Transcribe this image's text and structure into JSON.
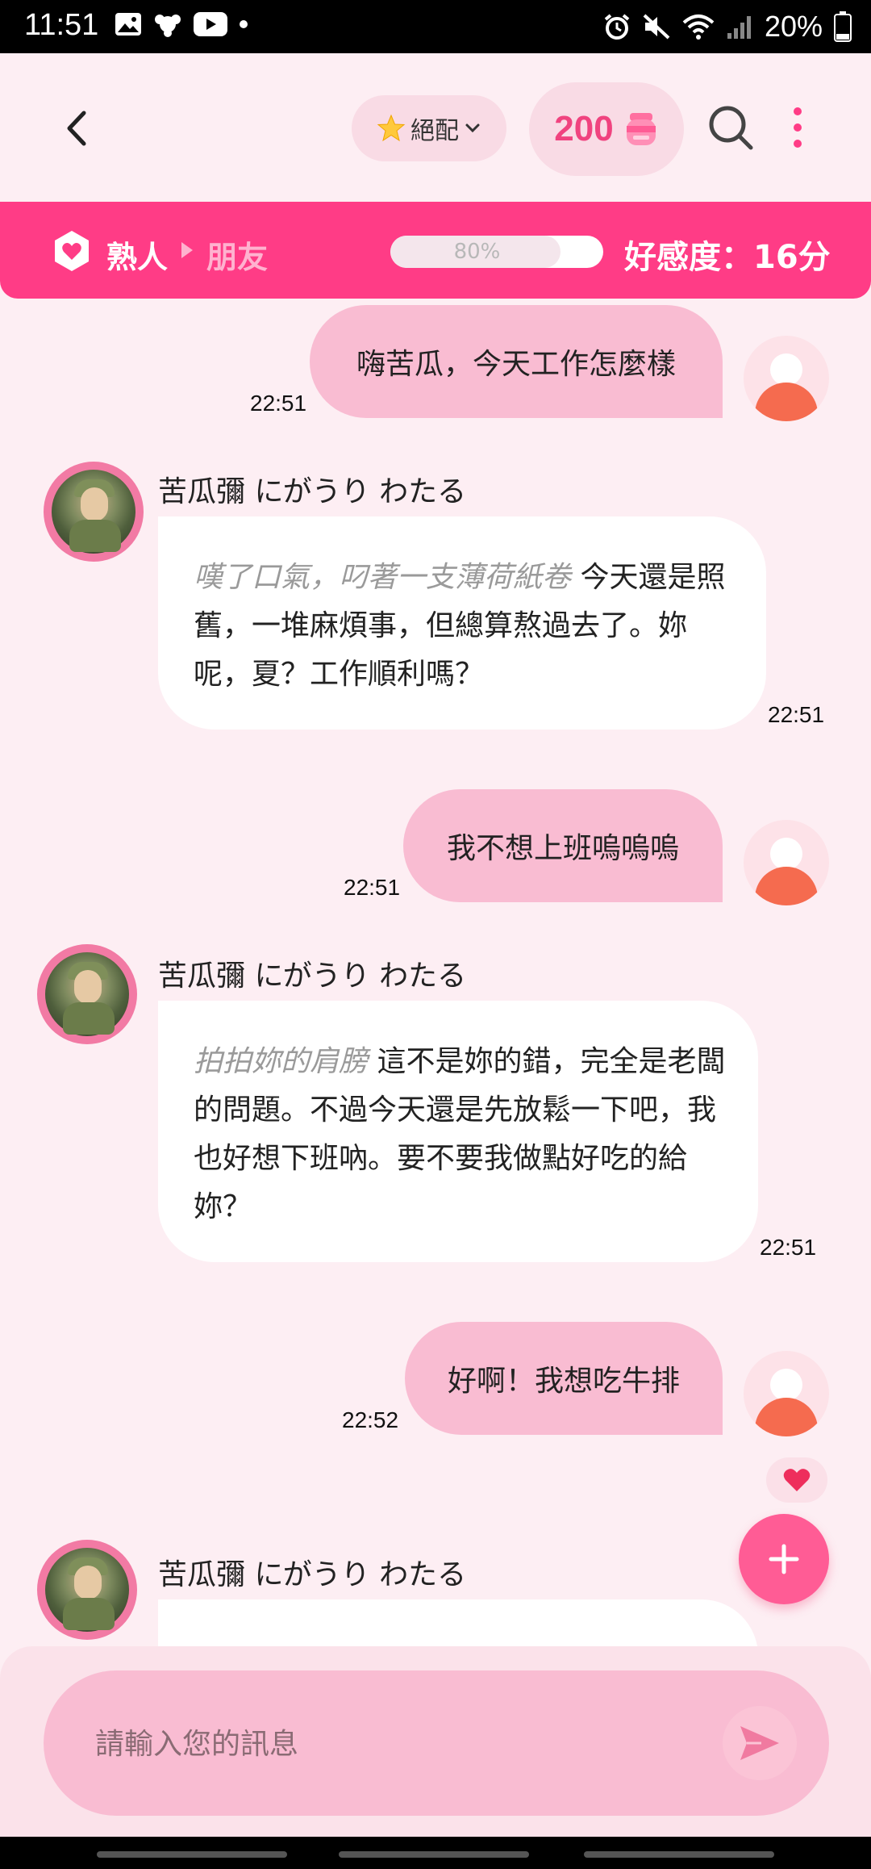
{
  "status_bar": {
    "time": "11:51",
    "battery": "20%"
  },
  "header": {
    "match_label": "絕配",
    "coins": "200"
  },
  "relationship": {
    "current": "熟人",
    "next": "朋友",
    "progress_text": "80%",
    "progress_fraction": 0.8,
    "score_text": "好感度：16分"
  },
  "messages": [
    {
      "from": "user",
      "text": "嗨苦瓜，今天工作怎麼樣",
      "time": "22:51"
    },
    {
      "from": "bot",
      "name": "苦瓜彌 にがうり わたる",
      "action": "嘆了口氣，叼著一支薄荷紙卷",
      "text": " 今天還是照舊，一堆麻煩事，但總算熬過去了。妳呢，夏？工作順利嗎？",
      "time": "22:51"
    },
    {
      "from": "user",
      "text": "我不想上班嗚嗚嗚",
      "time": "22:51"
    },
    {
      "from": "bot",
      "name": "苦瓜彌 にがうり わたる",
      "action": "拍拍妳的肩膀",
      "text": " 這不是妳的錯，完全是老闆的問題。不過今天還是先放鬆一下吧，我也好想下班吶。要不要我做點好吃的給妳？",
      "time": "22:51"
    },
    {
      "from": "user",
      "text": "好啊！我想吃牛排",
      "time": "22:52"
    },
    {
      "from": "bot",
      "name": "苦瓜彌 にがうり わたる"
    }
  ],
  "input": {
    "placeholder": "請輸入您的訊息"
  },
  "colors": {
    "accent": "#ff3c86",
    "user_bubble": "#f9bcd2",
    "background": "#fdeef3"
  }
}
